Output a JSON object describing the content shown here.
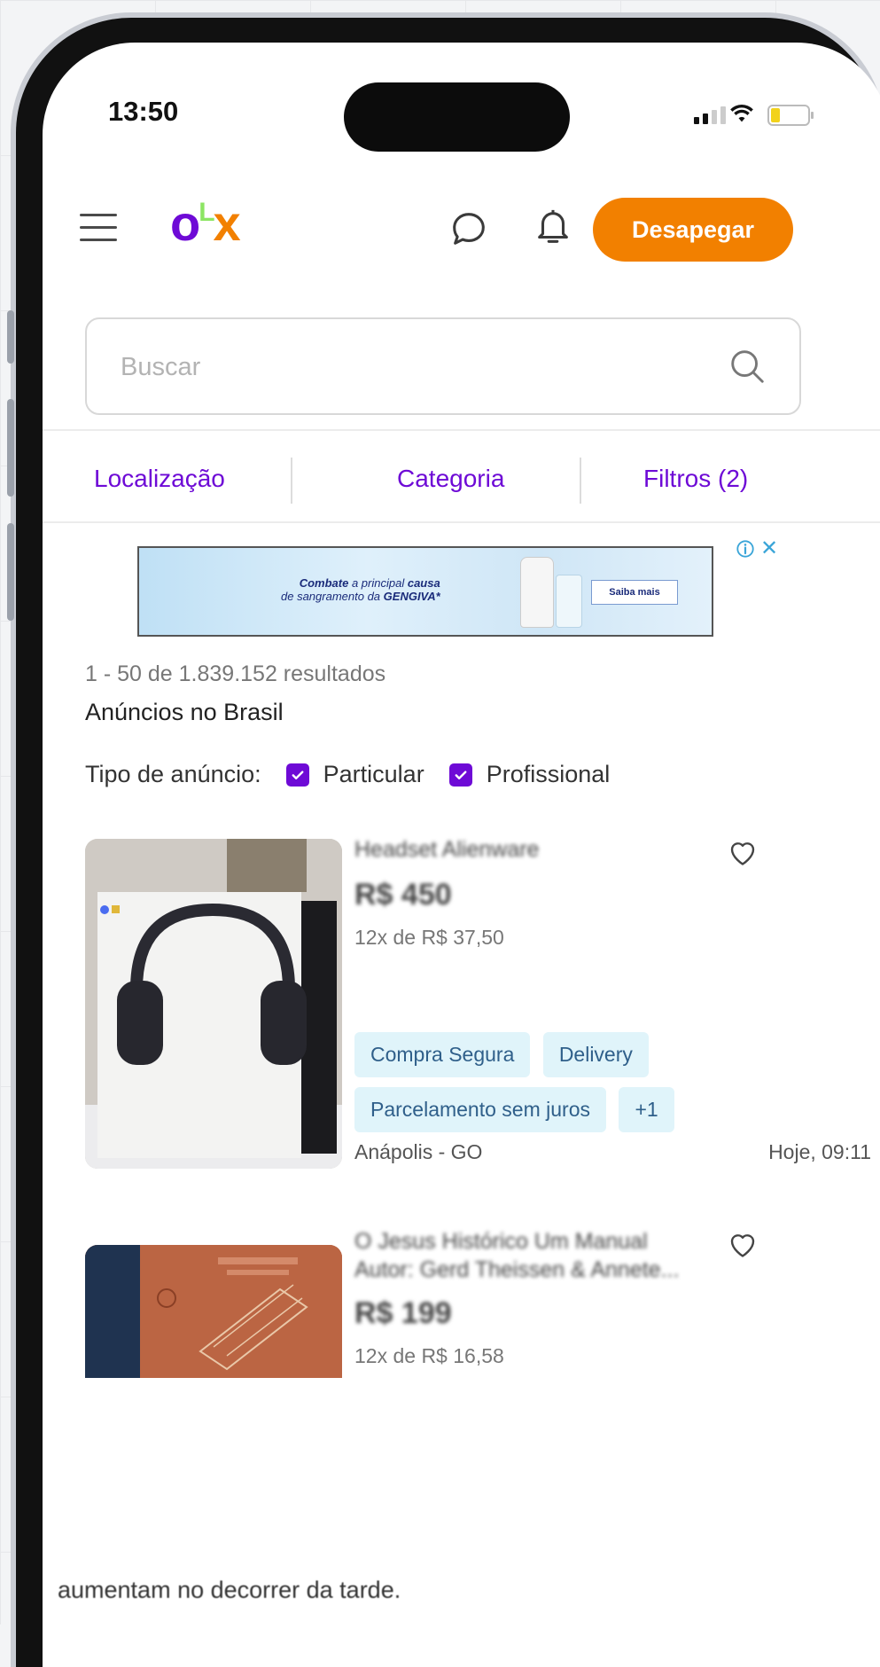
{
  "status_bar": {
    "time": "13:50"
  },
  "header": {
    "logo": {
      "o": "o",
      "l": "L",
      "x": "x"
    },
    "cta_label": "Desapegar",
    "colors": {
      "brand_purple": "#6e0ad6",
      "brand_orange": "#f28000",
      "brand_green": "#8ce563"
    }
  },
  "search": {
    "placeholder": "Buscar",
    "value": ""
  },
  "filters": {
    "location": "Localização",
    "category": "Categoria",
    "filters": "Filtros (2)"
  },
  "ad": {
    "line1_a": "Combate",
    "line1_b": "a principal",
    "line1_c": "causa",
    "line2_a": "de sangramento da",
    "line2_b": "GENGIVA*",
    "cta": "Saiba mais"
  },
  "results": {
    "count": "1 - 50 de 1.839.152 resultados",
    "region": "Anúncios no Brasil",
    "type_label": "Tipo de anúncio:",
    "type_options": [
      "Particular",
      "Profissional"
    ]
  },
  "listings": [
    {
      "title": "Headset Alienware",
      "price": "R$ 450",
      "installments": "12x de R$ 37,50",
      "tags": [
        "Compra Segura",
        "Delivery",
        "Parcelamento sem juros",
        "+1"
      ],
      "location": "Anápolis - GO",
      "date": "Hoje, 09:11"
    },
    {
      "title": "O Jesus Histórico Um Manual Autor: Gerd Theissen & Annete...",
      "price": "R$ 199",
      "installments": "12x de R$ 16,58"
    }
  ],
  "caption": "aumentam no decorrer da tarde."
}
